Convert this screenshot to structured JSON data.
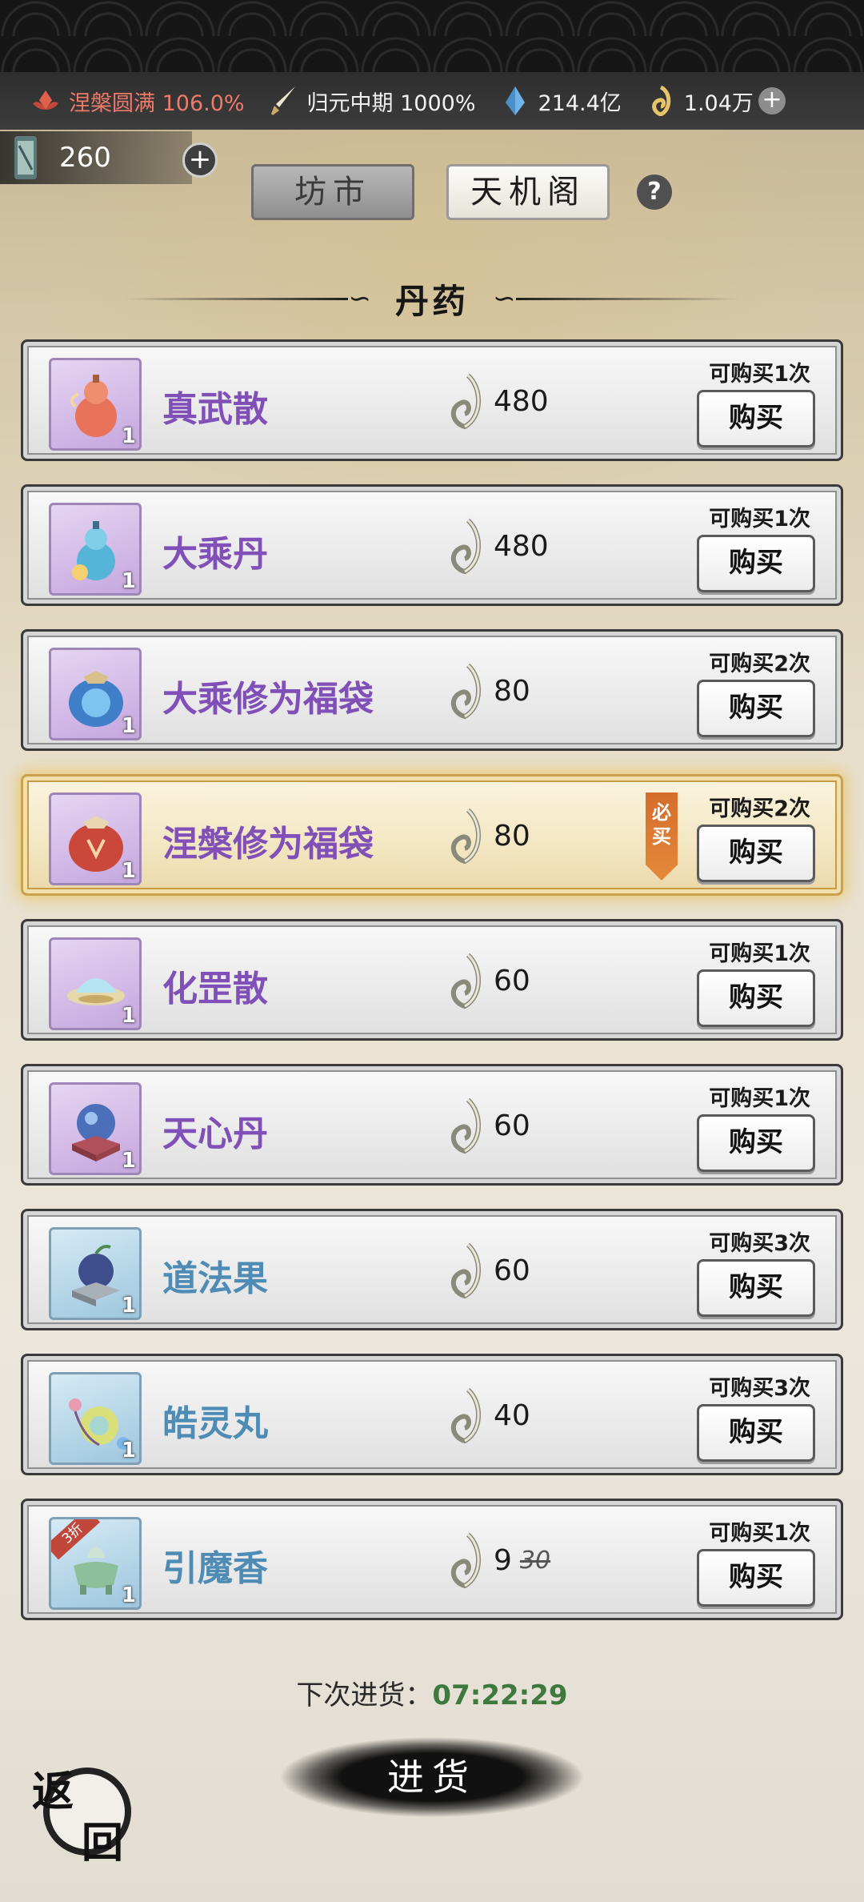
{
  "status_bar": {
    "realm": "涅槃圆满 106.0%",
    "cultivation": "归元中期 1000%",
    "spirit_stones": "214.4亿",
    "jade_currency": "1.04万"
  },
  "scroll_count": "260",
  "tabs": {
    "market": "坊市",
    "tianji": "天机阁"
  },
  "help_label": "?",
  "section_title": "丹药",
  "items": [
    {
      "name": "真武散",
      "price": "480",
      "limit": "可购买1次",
      "buy": "购买",
      "qty": "1"
    },
    {
      "name": "大乘丹",
      "price": "480",
      "limit": "可购买1次",
      "buy": "购买",
      "qty": "1"
    },
    {
      "name": "大乘修为福袋",
      "price": "80",
      "limit": "可购买2次",
      "buy": "购买",
      "qty": "1"
    },
    {
      "name": "涅槃修为福袋",
      "price": "80",
      "limit": "可购买2次",
      "buy": "购买",
      "qty": "1",
      "tag": "必买"
    },
    {
      "name": "化罡散",
      "price": "60",
      "limit": "可购买1次",
      "buy": "购买",
      "qty": "1"
    },
    {
      "name": "天心丹",
      "price": "60",
      "limit": "可购买1次",
      "buy": "购买",
      "qty": "1"
    },
    {
      "name": "道法果",
      "price": "60",
      "limit": "可购买3次",
      "buy": "购买",
      "qty": "1"
    },
    {
      "name": "皓灵丸",
      "price": "40",
      "limit": "可购买3次",
      "buy": "购买",
      "qty": "1"
    },
    {
      "name": "引魔香",
      "price": "9",
      "old_price": "30",
      "discount": "3折",
      "limit": "可购买1次",
      "buy": "购买",
      "qty": "1"
    }
  ],
  "restock": {
    "label": "下次进货：",
    "time": "07:22:29"
  },
  "restock_button": "进货",
  "back_button": {
    "c1": "返",
    "c2": "回"
  },
  "colors": {
    "name_purple": "#8050b8",
    "name_blue": "#4e8cb5",
    "timer_green": "#3e7a3e",
    "realm_red": "#f07a6a"
  }
}
